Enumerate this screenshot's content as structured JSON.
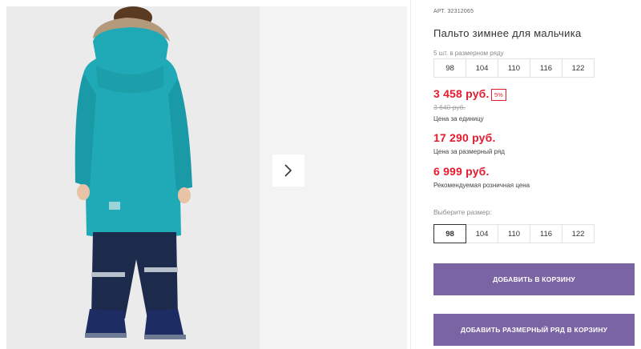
{
  "gallery": {
    "next_icon": "chevron-right-icon",
    "colors": {
      "jacket": "#1fa8b5",
      "fur": "#b49a7c",
      "pants": "#1c2a4c",
      "background": "#ebebeb"
    }
  },
  "product": {
    "article_label": "АРТ.",
    "article_number": "32312065",
    "title": "Пальто зимнее для мальчика",
    "pack_label": "5 шт. в размерном ряду",
    "pack_sizes": [
      "98",
      "104",
      "110",
      "116",
      "122"
    ],
    "price_unit": "3 458 руб.",
    "discount": "5%",
    "old_price": "3 640 руб.",
    "price_unit_note": "Цена за единицу",
    "price_pack": "17 290 руб.",
    "price_pack_note": "Цена за размерный ряд",
    "price_retail": "6 999 руб.",
    "price_retail_note": "Рекомендуемая розничная цена",
    "choose_label": "Выберите размер:",
    "choose_sizes": [
      "98",
      "104",
      "110",
      "116",
      "122"
    ],
    "selected_size": "98",
    "add_to_cart": "ДОБАВИТЬ В КОРЗИНУ",
    "add_pack_to_cart": "ДОБАВИТЬ РАЗМЕРНЫЙ РЯД В КОРЗИНУ"
  },
  "colors": {
    "accent": "#7b64a4",
    "price": "#e21b2e"
  }
}
